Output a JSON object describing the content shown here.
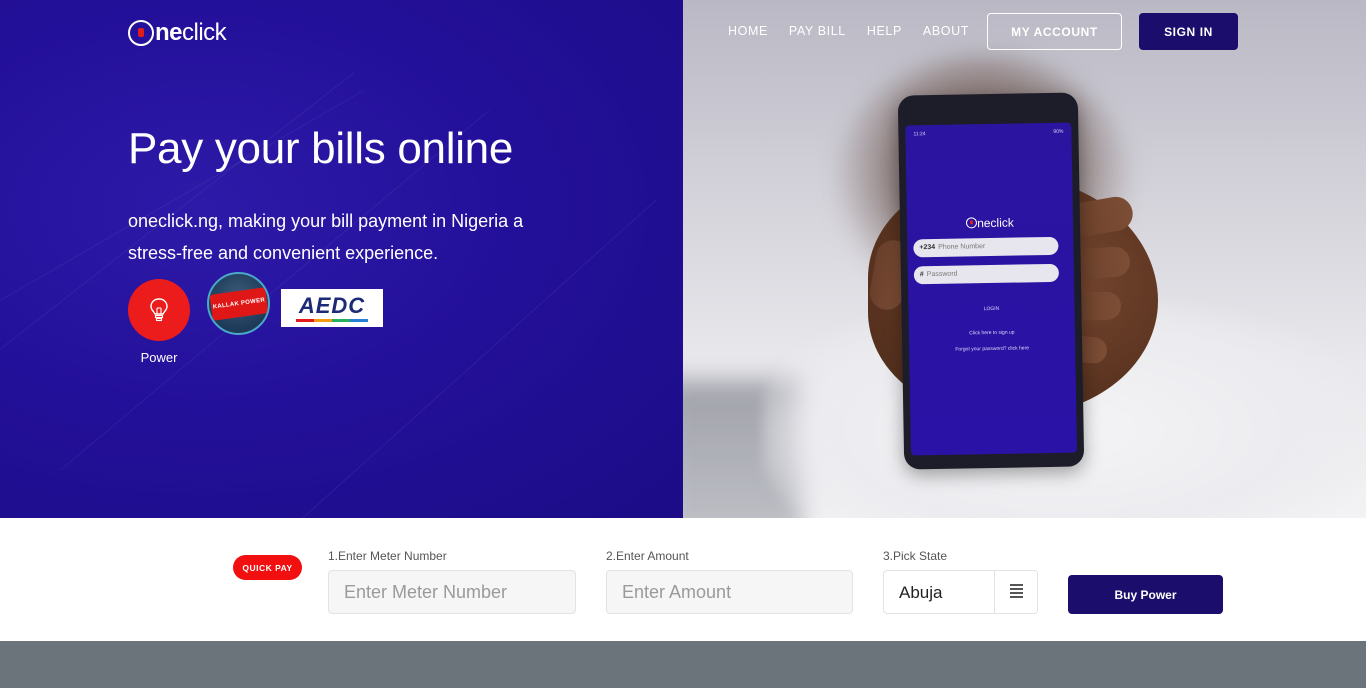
{
  "brand": {
    "logo_prefix": "ne",
    "logo_suffix": "click"
  },
  "nav": {
    "links": [
      "HOME",
      "PAY BILL",
      "HELP",
      "ABOUT"
    ],
    "my_account": "MY ACCOUNT",
    "sign_in": "SIGN IN"
  },
  "hero": {
    "headline": "Pay your bills online",
    "subline": "oneclick.ng, making your bill payment in Nigeria a stress-free and convenient experience.",
    "power_label": "Power",
    "kallak_text": "KALLAK POWER",
    "aedc_text": "AEDC",
    "phone": {
      "status_time": "11:24",
      "status_battery": "90%",
      "logo_suffix": "neclick",
      "country_code": "+234",
      "phone_placeholder": "Phone Number",
      "password_prefix": "#",
      "password_placeholder": "Password",
      "login": "LOGIN",
      "signup": "Click here to sign up",
      "forgot": "Forgot your password? click here"
    }
  },
  "quick_pay": {
    "badge": "QUICK PAY",
    "meter_label": "1.Enter Meter Number",
    "meter_placeholder": "Enter Meter Number",
    "amount_label": "2.Enter Amount",
    "amount_placeholder": "Enter Amount",
    "state_label": "3.Pick State",
    "state_value": "Abuja",
    "buy_button": "Buy Power"
  },
  "colors": {
    "hero_purple": "#23109a",
    "navy_button": "#1a0d6b",
    "red_accent": "#ec1c1c",
    "footer_gray": "#6b747b"
  }
}
